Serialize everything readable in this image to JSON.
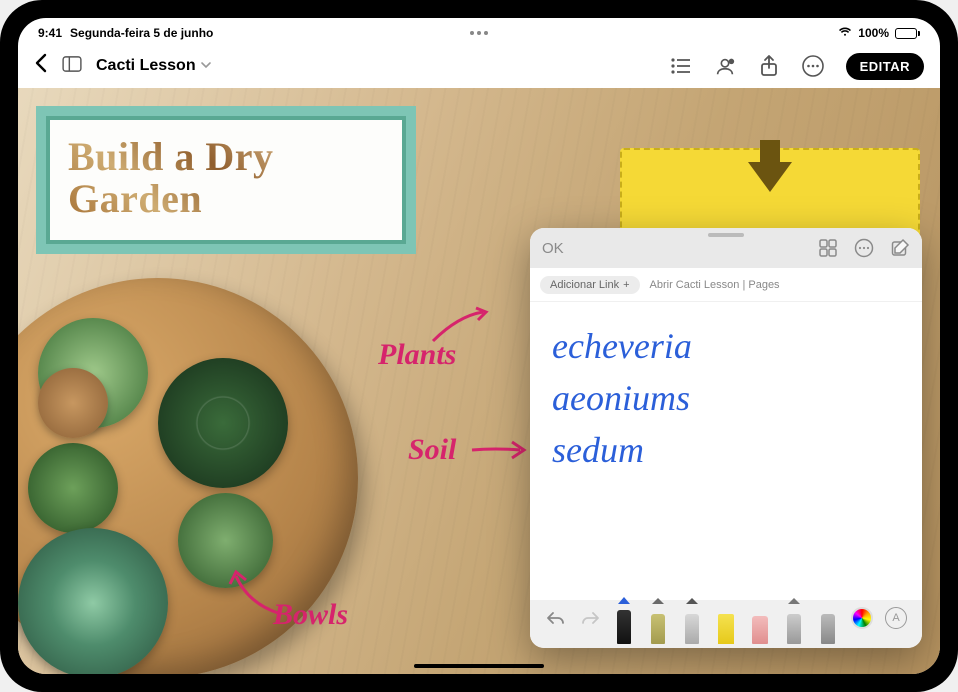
{
  "status": {
    "time": "9:41",
    "date": "Segunda-feira 5 de junho",
    "battery_pct": "100%"
  },
  "app": {
    "document_title": "Cacti Lesson",
    "edit_label": "EDITAR"
  },
  "slide": {
    "title": "Build a Dry Garden",
    "annotations": {
      "plants": "Plants",
      "soil": "Soil",
      "bowls": "Bowls"
    }
  },
  "quicknote": {
    "ok_label": "OK",
    "add_link_label": "Adicionar Link",
    "open_link_label": "Abrir Cacti Lesson | Pages",
    "lines": [
      "echeveria",
      "aeoniums",
      "sedum"
    ],
    "tools": {
      "undo": "undo",
      "redo": "redo",
      "pen_blue": "#2b5fd9",
      "pencil": "#9aa05a",
      "marker": "#f5d936",
      "eraser": "#f2a8a8",
      "crayon": "#7a7a7a",
      "text_tool_glyph": "A"
    }
  }
}
